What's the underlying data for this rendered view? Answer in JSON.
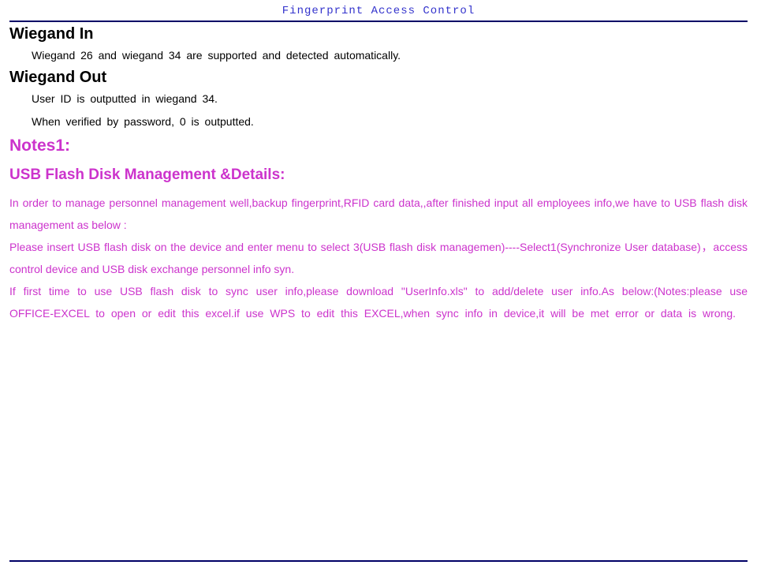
{
  "header": {
    "title": "Fingerprint Access Control"
  },
  "wiegand_in": {
    "heading": "Wiegand In",
    "line1": "Wiegand 26 and wiegand 34 are supported and detected automatically."
  },
  "wiegand_out": {
    "heading": "Wiegand Out",
    "line1": "User ID is outputted in wiegand 34.",
    "line2": "When verified by password, 0 is outputted."
  },
  "notes": {
    "heading": "Notes1:",
    "subheading": "USB Flash Disk Management &Details:",
    "p1": "In order to manage personnel management well,backup fingerprint,RFID card data,,after finished input all employees info,we have to USB flash disk management as below :",
    "p2": "Please insert USB flash disk on the device and enter menu to select 3(USB flash disk managemen)----Select1(Synchronize User database)，access control device and USB disk exchange personnel info syn.",
    "p3": "If first time to use USB flash disk to sync user info,please download \"UserInfo.xls\" to add/delete user info.As below:(Notes:please use OFFICE-EXCEL to open or edit this excel.if use WPS to edit this EXCEL,when sync info in device,it will be met error or data is wrong."
  }
}
